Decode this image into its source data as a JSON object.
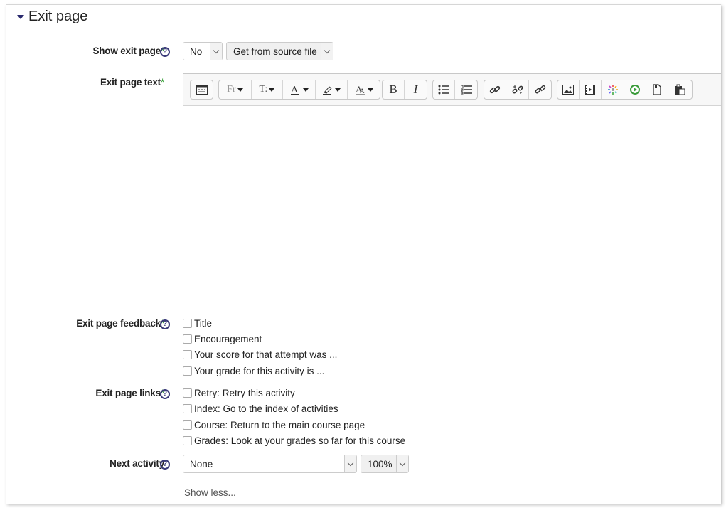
{
  "section": {
    "title": "Exit page"
  },
  "show_exit_page": {
    "label": "Show exit page",
    "required_mark": "*",
    "value": "No",
    "source_select": "Get from source file"
  },
  "exit_page_text": {
    "label": "Exit page text",
    "required_mark": "*",
    "toolbar": {
      "font_label": "Fr",
      "size_label": "T:",
      "bold_label": "B",
      "italic_label": "I"
    }
  },
  "exit_page_feedback": {
    "label": "Exit page feedback",
    "required_mark": "*",
    "options": [
      "Title",
      "Encouragement",
      "Your score for that attempt was ...",
      "Your grade for this activity is ..."
    ]
  },
  "exit_page_links": {
    "label": "Exit page links",
    "required_mark": "*",
    "options": [
      "Retry: Retry this activity",
      "Index: Go to the index of activities",
      "Course: Return to the main course page",
      "Grades: Look at your grades so far for this course"
    ]
  },
  "next_activity": {
    "label": "Next activity",
    "value": "None",
    "percent": "100%"
  },
  "show_less": "Show less...",
  "colors": {
    "required": "#2b9a2b",
    "icon": "#3b3b7a"
  }
}
